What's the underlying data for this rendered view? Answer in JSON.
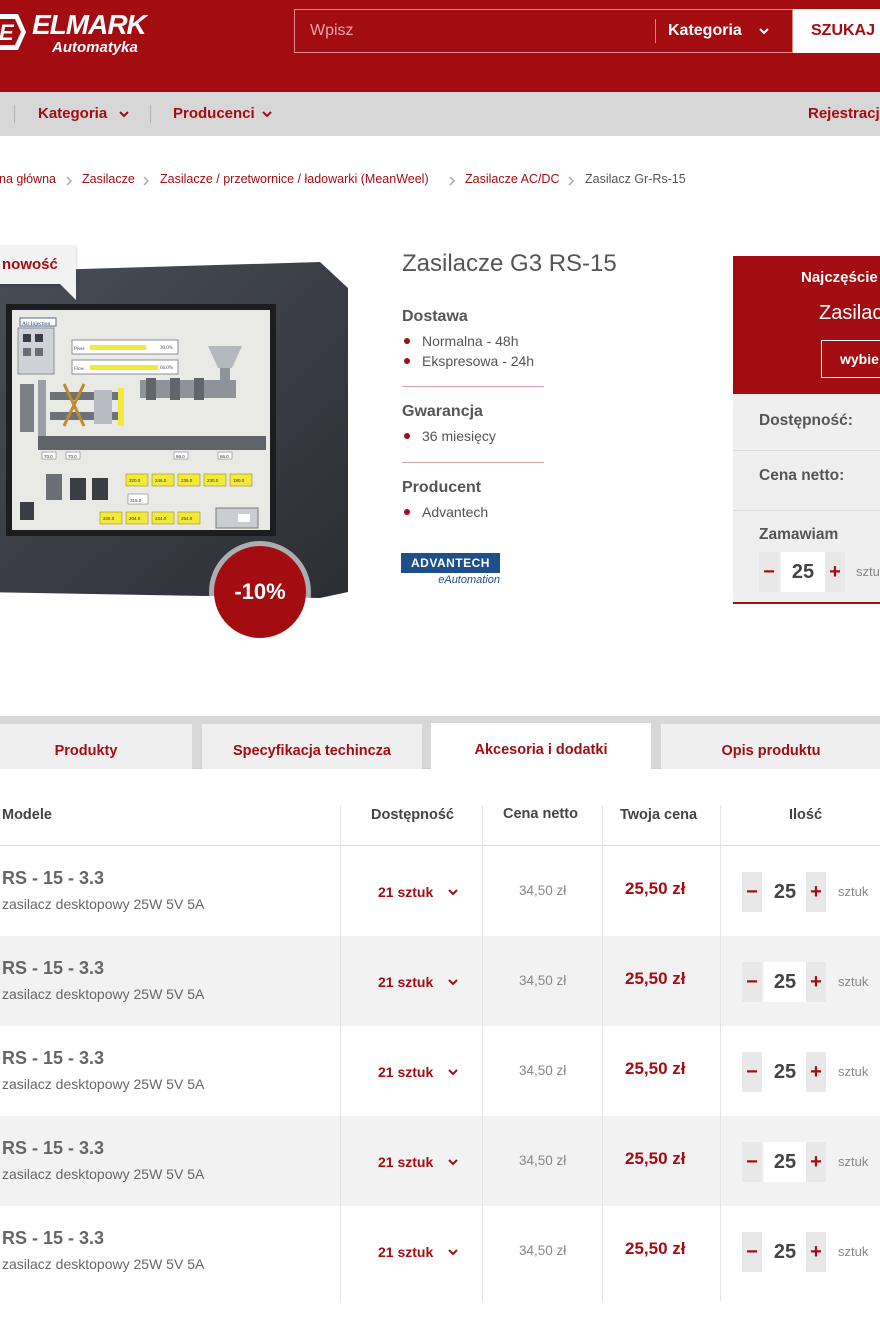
{
  "header": {
    "logo_name": "ELMARK",
    "logo_sub": "Automatyka",
    "search_placeholder": "Wpisz",
    "search_category": "Kategoria",
    "search_button": "SZUKAJ"
  },
  "nav": {
    "items": [
      "Kategoria",
      "Producenci"
    ],
    "register": "Rejestracja"
  },
  "breadcrumb": [
    "na główna",
    "Zasilacze",
    "Zasilacze / przetwornice / ładowarki (MeanWeel)",
    "Zasilacze AC/DC",
    "Zasilacz Gr-Rs-15"
  ],
  "product": {
    "badge_new": "nowość",
    "discount": "-10%",
    "title": "Zasilacze G3 RS-15",
    "delivery_heading": "Dostawa",
    "delivery_items": [
      "Normalna - 48h",
      "Ekspresowa - 24h"
    ],
    "warranty_heading": "Gwarancja",
    "warranty_items": [
      "36 miesięcy"
    ],
    "producer_heading": "Producent",
    "producer_items": [
      "Advantech"
    ],
    "brand_logo_top": "ADVANTECH",
    "brand_logo_bottom": "eAutomation"
  },
  "sidebox": {
    "title": "Najczęście",
    "name": "Zasilac",
    "button": "wybie",
    "availability_label": "Dostępność:",
    "net_price_label": "Cena netto:",
    "order_label": "Zamawiam",
    "quantity": "25",
    "unit": "sztu",
    "minus": "−",
    "plus": "+"
  },
  "tabs": [
    {
      "label": "Produkty",
      "active": false
    },
    {
      "label": "Specyfikacja techincza",
      "active": false
    },
    {
      "label": "Akcesoria i dodatki",
      "active": true
    },
    {
      "label": "Opis produktu",
      "active": false
    }
  ],
  "table": {
    "headers": [
      "Modele",
      "Dostępność",
      "Cena netto",
      "Twoja cena",
      "Ilość"
    ],
    "rows": [
      {
        "name": "RS - 15 - 3.3",
        "desc": "zasilacz desktopowy 25W 5V 5A",
        "availability": "21 sztuk",
        "net": "34,50 zł",
        "price": "25,50 zł",
        "qty": "25",
        "unit": "sztuk"
      },
      {
        "name": "RS - 15 - 3.3",
        "desc": "zasilacz desktopowy 25W 5V 5A",
        "availability": "21 sztuk",
        "net": "34,50 zł",
        "price": "25,50 zł",
        "qty": "25",
        "unit": "sztuk"
      },
      {
        "name": "RS - 15 - 3.3",
        "desc": "zasilacz desktopowy 25W 5V 5A",
        "availability": "21 sztuk",
        "net": "34,50 zł",
        "price": "25,50 zł",
        "qty": "25",
        "unit": "sztuk"
      },
      {
        "name": "RS - 15 - 3.3",
        "desc": "zasilacz desktopowy 25W 5V 5A",
        "availability": "21 sztuk",
        "net": "34,50 zł",
        "price": "25,50 zł",
        "qty": "25",
        "unit": "sztuk"
      },
      {
        "name": "RS - 15 - 3.3",
        "desc": "zasilacz desktopowy 25W 5V 5A",
        "availability": "21 sztuk",
        "net": "34,50 zł",
        "price": "25,50 zł",
        "qty": "25",
        "unit": "sztuk"
      }
    ]
  },
  "screen_labels": {
    "title": "Air Injection",
    "press": "Press",
    "flow": "Flow",
    "press_value": "30.0%",
    "flow_value": "66.0%",
    "bottom_values": [
      "70.0",
      "70.0",
      "66.0",
      "66.0"
    ],
    "box_values": [
      "320.0",
      "246.0",
      "236.0",
      "230.0",
      "180.0",
      "205.0",
      "204.0",
      "234.0",
      "254.0",
      "315.0"
    ]
  },
  "colors": {
    "brand": "#a30d12",
    "nav_bg": "#d7d7d7",
    "row_alt": "#f2f2f2"
  },
  "icons": {
    "search_category_chevron": "chevron-down-icon",
    "breadcrumb_separator": "chevron-right-icon",
    "availability_chevron": "chevron-down-icon"
  }
}
